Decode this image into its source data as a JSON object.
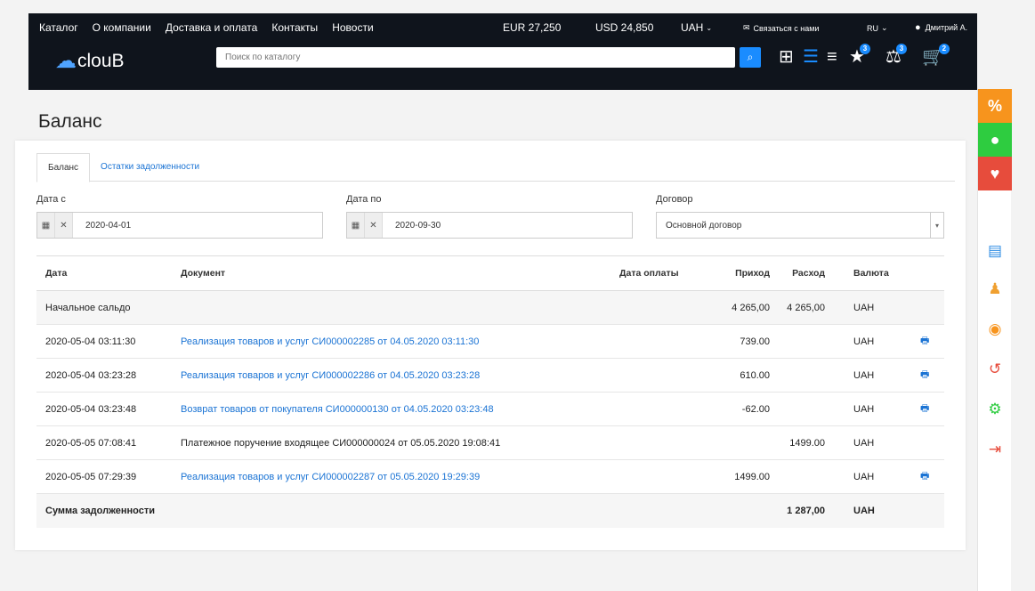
{
  "header": {
    "nav": [
      "Каталог",
      "О компании",
      "Доставка и оплата",
      "Контакты",
      "Новости"
    ],
    "eur": "EUR 27,250",
    "usd": "USD 24,850",
    "currency": "UAH",
    "contact": "Связаться с нами",
    "lang": "RU",
    "user": "Дмитрий А.",
    "logo": "clouB",
    "search_placeholder": "Поиск по каталогу",
    "badges": {
      "favorites": "3",
      "compare": "3",
      "cart": "2"
    }
  },
  "page": {
    "title": "Баланс"
  },
  "tabs": [
    "Баланс",
    "Остатки задолженности"
  ],
  "filters": {
    "date_from_label": "Дата с",
    "date_from": "2020-04-01",
    "date_to_label": "Дата по",
    "date_to": "2020-09-30",
    "contract_label": "Договор",
    "contract": "Основной договор"
  },
  "table": {
    "headers": [
      "Дата",
      "Документ",
      "Дата оплаты",
      "Приход",
      "Расход",
      "Валюта"
    ],
    "opening": {
      "label": "Начальное сальдо",
      "in": "4 265,00",
      "out": "4 265,00",
      "cur": "UAH"
    },
    "rows": [
      {
        "date": "2020-05-04 03:11:30",
        "doc": "Реализация товаров и услуг СИ000002285 от 04.05.2020 03:11:30",
        "in": "739.00",
        "out": "",
        "cur": "UAH",
        "link": true
      },
      {
        "date": "2020-05-04 03:23:28",
        "doc": "Реализация товаров и услуг СИ000002286 от 04.05.2020 03:23:28",
        "in": "610.00",
        "out": "",
        "cur": "UAH",
        "link": true
      },
      {
        "date": "2020-05-04 03:23:48",
        "doc": "Возврат товаров от покупателя СИ000000130 от 04.05.2020 03:23:48",
        "in": "-62.00",
        "out": "",
        "cur": "UAH",
        "link": true
      },
      {
        "date": "2020-05-05 07:08:41",
        "doc": "Платежное поручение входящее СИ000000024 от 05.05.2020 19:08:41",
        "in": "",
        "out": "1499.00",
        "cur": "UAH",
        "link": false
      },
      {
        "date": "2020-05-05 07:29:39",
        "doc": "Реализация товаров и услуг СИ000002287 от 05.05.2020 19:29:39",
        "in": "1499.00",
        "out": "",
        "cur": "UAH",
        "link": true
      }
    ],
    "total": {
      "label": "Сумма задолженности",
      "out": "1 287,00",
      "cur": "UAH"
    }
  },
  "colors": {
    "accent": "#1a73d4",
    "header_bg": "#0f141c",
    "orange": "#f7941d",
    "green": "#2ecc40",
    "red": "#e74c3c"
  }
}
